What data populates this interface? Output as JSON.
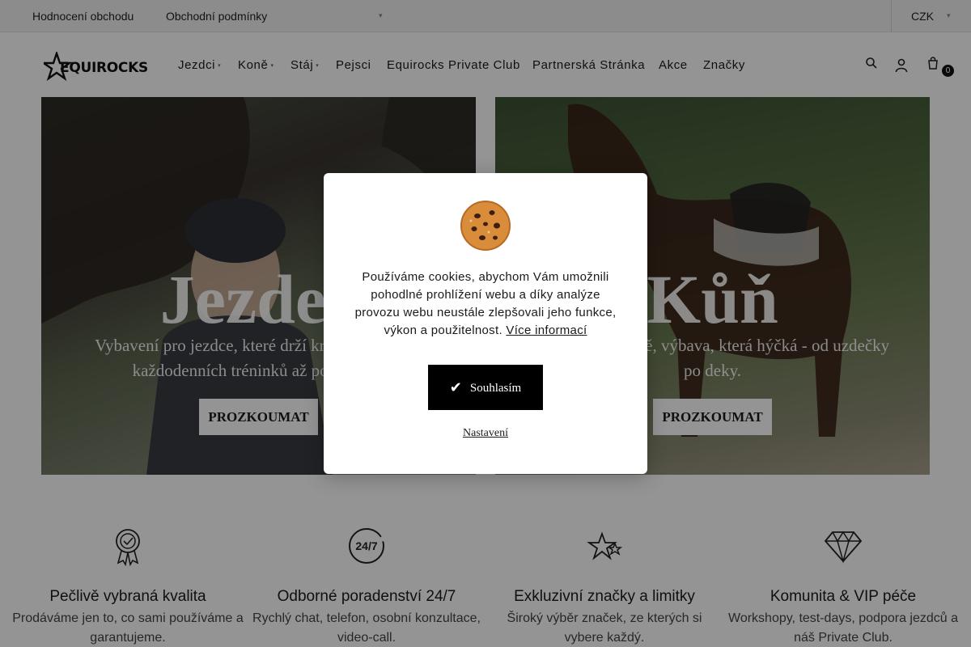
{
  "topbar": {
    "links": [
      "Hodnocení obchodu",
      "Obchodní podmínky"
    ],
    "currency": "CZK"
  },
  "header": {
    "logo_text": "EQUIROCKS",
    "nav": [
      {
        "label": "Jezdci",
        "has_dropdown": true
      },
      {
        "label": "Koně",
        "has_dropdown": true
      },
      {
        "label": "Stáj",
        "has_dropdown": true
      },
      {
        "label": "Pejsci",
        "has_dropdown": false
      },
      {
        "label": "Equirocks Private Club",
        "has_dropdown": false
      },
      {
        "label": "Partnerská Stránka",
        "has_dropdown": false
      },
      {
        "label": "Akce",
        "has_dropdown": false
      },
      {
        "label": "Značky",
        "has_dropdown": false
      }
    ],
    "icons": [
      "search-icon",
      "user-icon",
      "cart-icon"
    ],
    "cart_count": "0"
  },
  "banners": [
    {
      "title": "Jezdec",
      "text": "Vybavení pro jezdce, které drží krok s vámi - od každodenních tréninků až po závody.",
      "button": "PROZKOUMAT"
    },
    {
      "title": "Kůň",
      "text": "Výbava pro koně, výbava, která hýčká - od uzdečky po deky.",
      "button": "PROZKOUMAT"
    }
  ],
  "features": [
    {
      "icon": "award-ribbon-icon",
      "title": "Pečlivě vybraná kvalita",
      "text": "Prodáváme jen to, co sami používáme a garantujeme."
    },
    {
      "icon": "clock-24-7-icon",
      "title": "Odborné poradenství 24/7",
      "text": "Rychlý chat, telefon, osobní konzultace, video-call."
    },
    {
      "icon": "stars-icon",
      "title": "Exkluzivní značky a limitky",
      "text": "Široký výběr značek, ze kterých si vybere každý."
    },
    {
      "icon": "diamond-icon",
      "title": "Komunita & VIP péče",
      "text": "Workshopy, test-days, podpora jezdců a náš Private Club."
    }
  ],
  "cookie_modal": {
    "icon": "cookie-icon",
    "message": "Používáme cookies, abychom Vám umožnili pohodlné prohlížení webu a díky analýze provozu webu neustále zlepšovali jeho funkce, výkon a použitelnost.",
    "more_link": "Více informací",
    "accept_label": "Souhlasím",
    "settings_label": "Nastavení"
  },
  "colors": {
    "accent": "#000000",
    "overlay": "rgba(0,0,0,0.42)"
  }
}
